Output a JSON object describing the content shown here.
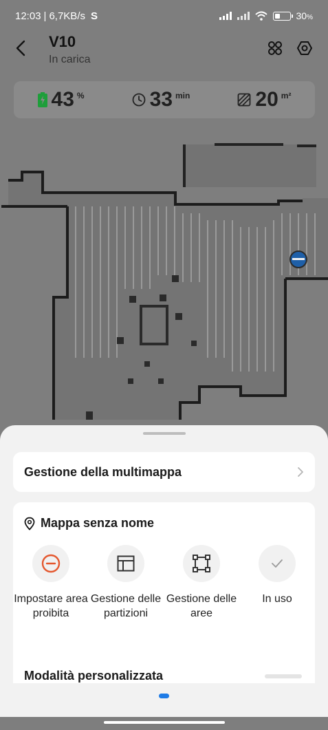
{
  "status_bar": {
    "time": "12:03",
    "separator": "|",
    "network_speed": "6,7KB/s",
    "app_glyph": "S",
    "battery_percent": "30",
    "battery_suffix": "%"
  },
  "header": {
    "device_name": "V10",
    "device_status": "In carica",
    "icons": [
      "back-arrow-icon",
      "grid-apps-icon",
      "settings-hexagon-icon"
    ]
  },
  "stats": {
    "battery": {
      "value": "43",
      "unit": "%",
      "icon": "battery-charging-icon",
      "color": "#1e9e3a"
    },
    "time": {
      "value": "33",
      "unit": "min",
      "icon": "clock-icon"
    },
    "area": {
      "value": "20",
      "unit": "m²",
      "icon": "area-hatched-icon"
    }
  },
  "sheet": {
    "multimap_label": "Gestione della multimappa",
    "map_name": "Mappa senza nome",
    "actions": [
      {
        "label": "Impostare area proibita",
        "icon": "no-entry-icon",
        "color": "#e4572e"
      },
      {
        "label": "Gestione delle partizioni",
        "icon": "partition-layout-icon"
      },
      {
        "label": "Gestione delle aree",
        "icon": "area-square-icon"
      },
      {
        "label": "In uso",
        "icon": "checkmark-icon"
      }
    ],
    "custom_mode_label": "Modalità personalizzata"
  },
  "colors": {
    "accent": "#1e7be6",
    "overlay": "#7e7e7e",
    "sheet_bg": "#f2f2f2"
  }
}
